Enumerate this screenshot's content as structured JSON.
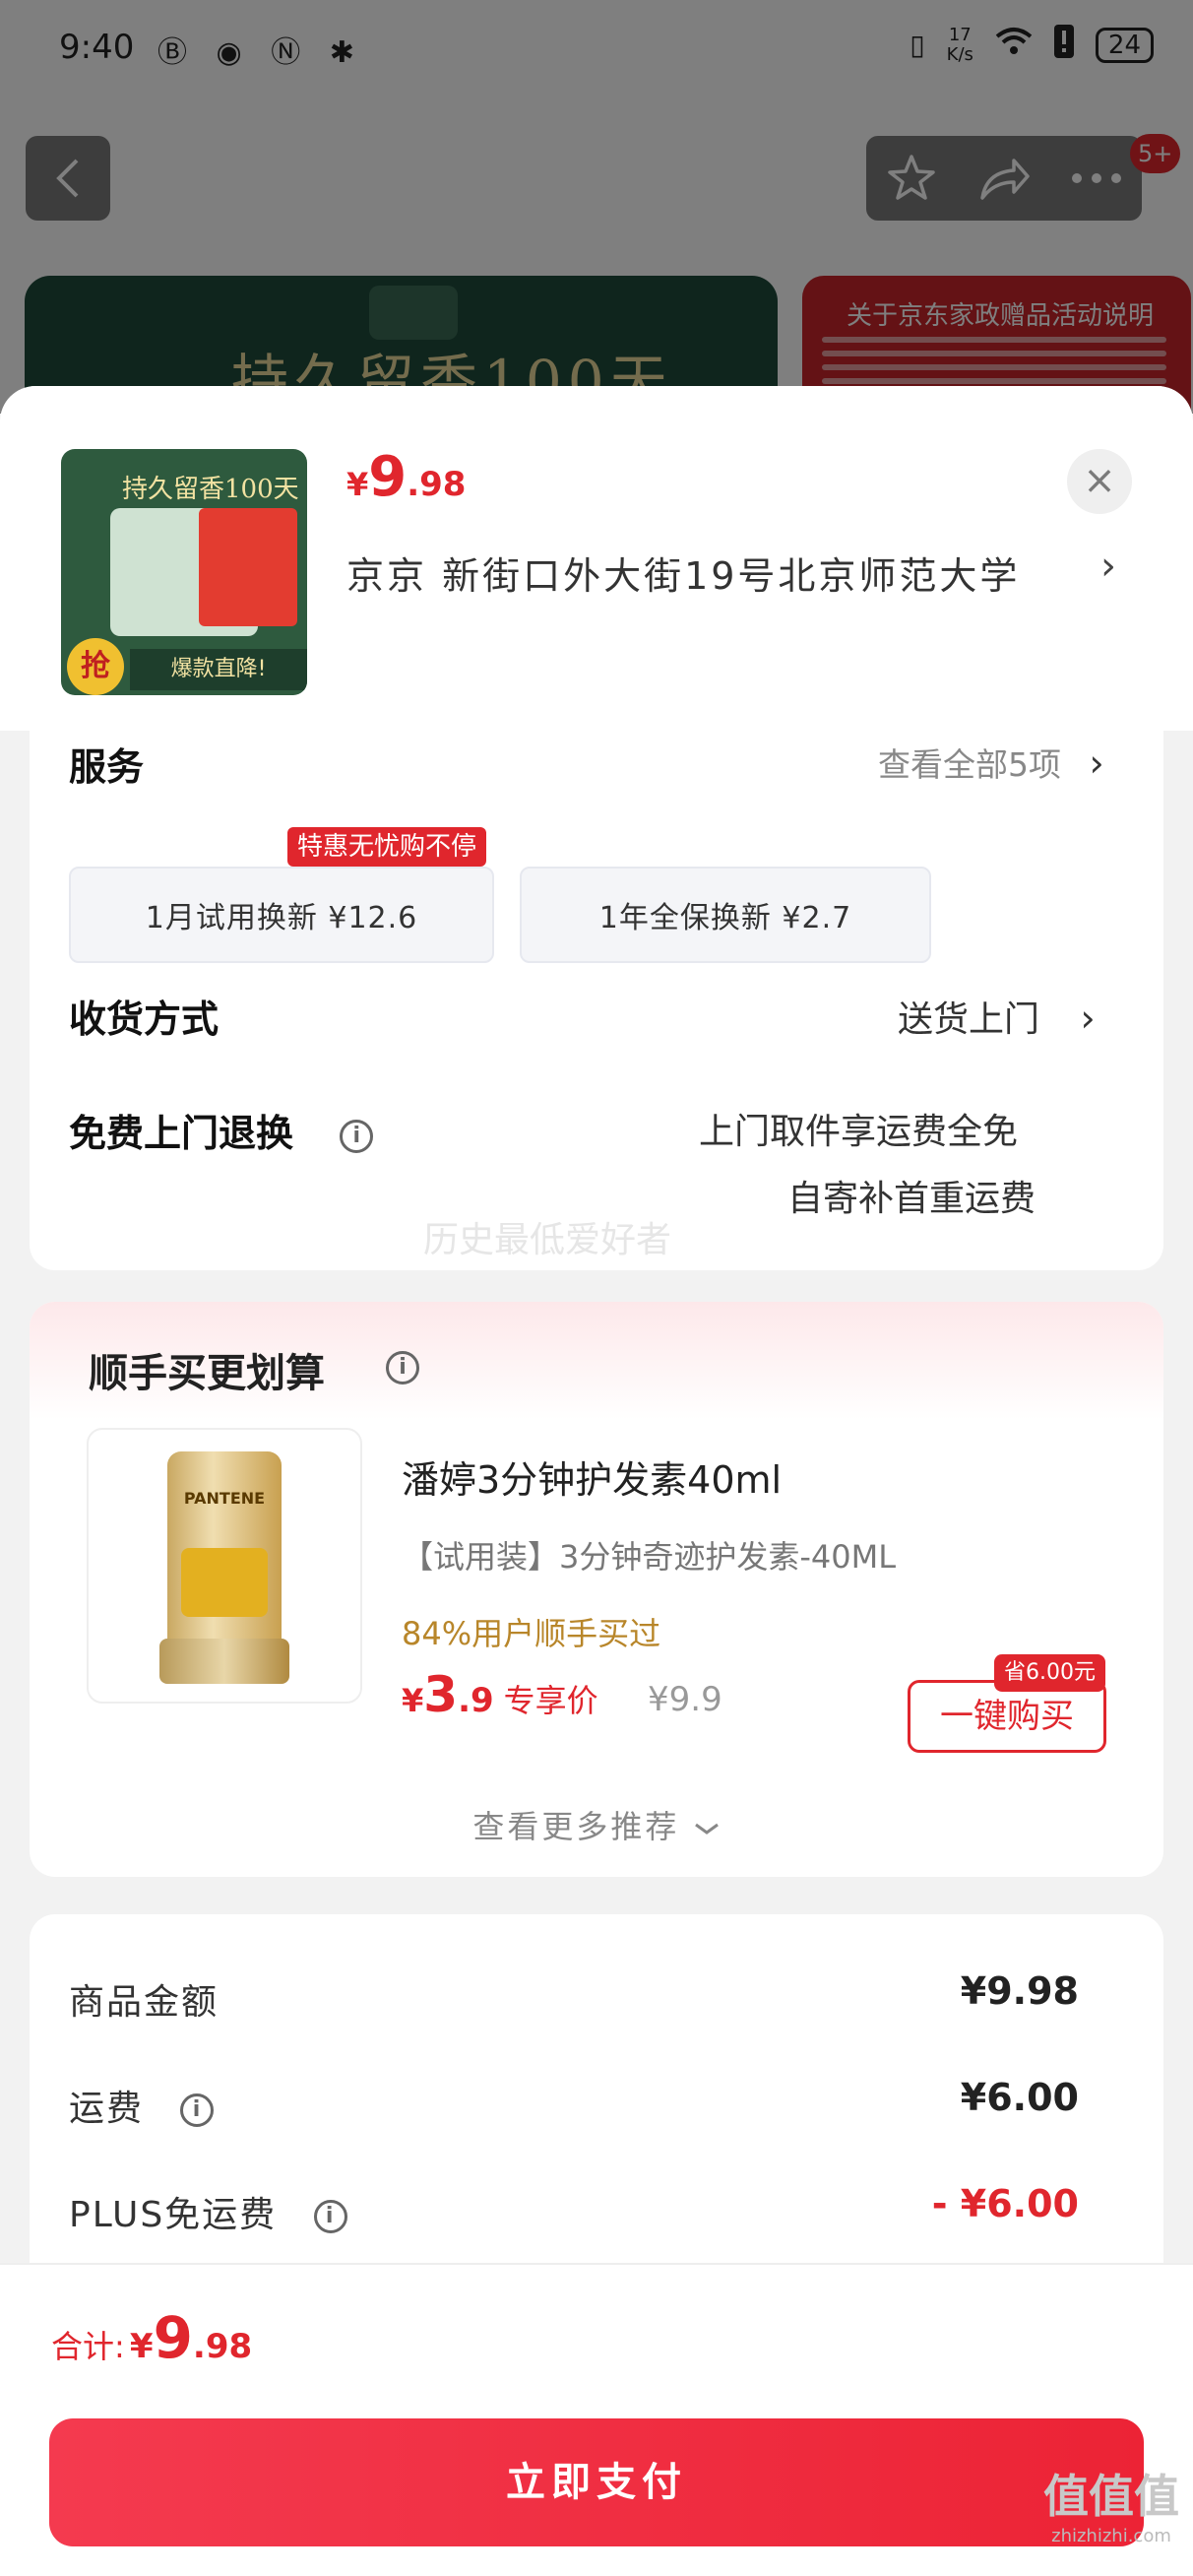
{
  "status_bar": {
    "time": "9:40",
    "left_icons": "Ⓑ ◉ Ⓝ ✱",
    "speed_value": "17",
    "speed_unit": "K/s",
    "battery": "24"
  },
  "nav": {
    "badge": "5+"
  },
  "background": {
    "banner_title": "持久留香100天",
    "notice_title": "关于京东家政赠品活动说明"
  },
  "product": {
    "thumb_title": "持久留香100天",
    "thumb_bottom": "爆款直降!",
    "thumb_grab": "抢",
    "price_currency": "¥",
    "price_int": "9",
    "price_dec": ".98",
    "address": "京京   新街口外大街19号北京师范大学",
    "close": "×"
  },
  "service": {
    "label": "服务",
    "view_all": "查看全部5项",
    "chips": [
      {
        "label": "1月试用换新   ¥12.6"
      },
      {
        "label": "1年全保换新   ¥2.7"
      }
    ],
    "promo_tag": "特惠无忧购不停"
  },
  "delivery": {
    "label": "收货方式",
    "value": "送货上门"
  },
  "return": {
    "label": "免费上门退换",
    "line1": "上门取件享运费全免",
    "line2": "自寄补首重运费"
  },
  "watermark_text": "历史最低爱好者",
  "combo": {
    "title": "顺手买更划算",
    "product_image_label": "PANTENE",
    "name": "潘婷3分钟护发素40ml",
    "desc": "【试用装】3分钟奇迹护发素-40ML",
    "rate": "84%用户顺手买过",
    "price_currency": "¥",
    "price_int": "3",
    "price_dec": ".9",
    "price_tag": "专享价",
    "orig_price": "¥9.9",
    "buy_label": "一键购买",
    "save_tag": "省6.00元",
    "more": "查看更多推荐"
  },
  "summary": {
    "rows": [
      {
        "label": "商品金额",
        "value": "¥9.98",
        "color": "#222222"
      },
      {
        "label": "运费",
        "value": "¥6.00",
        "color": "#222222"
      },
      {
        "label": "PLUS免运费",
        "value": "- ¥6.00",
        "color": "#e0262d"
      }
    ]
  },
  "footer": {
    "total_label": "合计:",
    "total_currency": "¥",
    "total_int": "9",
    "total_dec": ".98",
    "pay_label": "立即支付",
    "logo_big": "值值值",
    "logo_small": "zhizhizhi.com"
  },
  "colors": {
    "accent": "#e0262d",
    "gold": "#b8862a"
  }
}
